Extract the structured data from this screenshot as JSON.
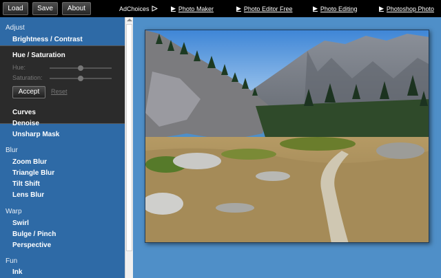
{
  "toolbar": {
    "load_label": "Load",
    "save_label": "Save",
    "about_label": "About"
  },
  "ads": {
    "adchoices_label": "AdChoices",
    "links": [
      "Photo Maker",
      "Photo Editor Free",
      "Photo Editing",
      "Photoshop Photo"
    ]
  },
  "sidebar": {
    "adjust": {
      "heading": "Adjust",
      "brightness_contrast": "Brightness / Contrast",
      "curves": "Curves",
      "denoise": "Denoise",
      "unsharp_mask": "Unsharp Mask"
    },
    "hue_panel": {
      "title": "Hue / Saturation",
      "hue_label": "Hue:",
      "saturation_label": "Saturation:",
      "accept_label": "Accept",
      "reset_label": "Reset",
      "hue_value": 0.5,
      "saturation_value": 0.5
    },
    "blur": {
      "heading": "Blur",
      "items": [
        "Zoom Blur",
        "Triangle Blur",
        "Tilt Shift",
        "Lens Blur"
      ]
    },
    "warp": {
      "heading": "Warp",
      "items": [
        "Swirl",
        "Bulge / Pinch",
        "Perspective"
      ]
    },
    "fun": {
      "heading": "Fun",
      "items": [
        "Ink"
      ]
    }
  },
  "colors": {
    "background": "#4f8fc8",
    "sidebar": "#2e6aa6",
    "panel": "#2b2b2b",
    "topbar": "#000000"
  }
}
